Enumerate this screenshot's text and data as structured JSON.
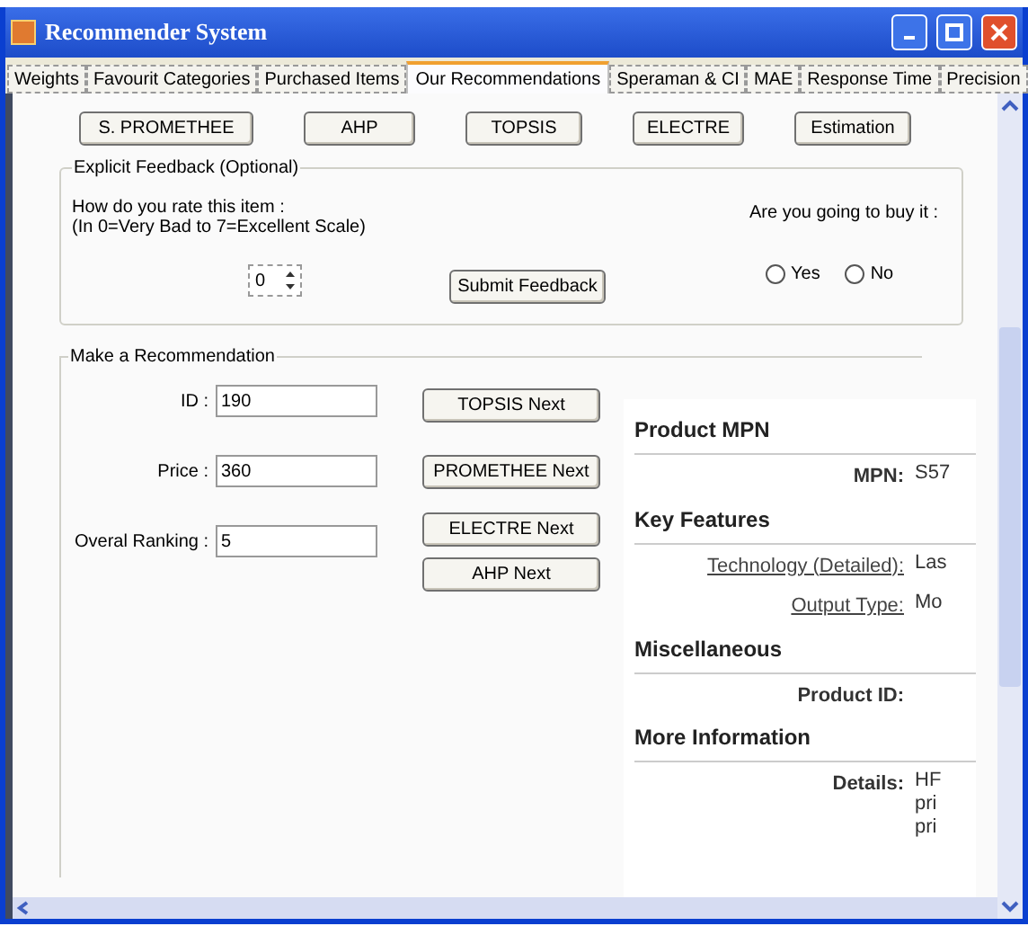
{
  "window": {
    "title": "Recommender System"
  },
  "tabs": [
    {
      "label": "Weights",
      "selected": false
    },
    {
      "label": "Favourit Categories",
      "selected": false
    },
    {
      "label": "Purchased Items",
      "selected": false
    },
    {
      "label": "Our Recommendations",
      "selected": true
    },
    {
      "label": "Speraman & CI",
      "selected": false
    },
    {
      "label": "MAE",
      "selected": false
    },
    {
      "label": "Response Time",
      "selected": false
    },
    {
      "label": "Precision",
      "selected": false
    }
  ],
  "method_buttons": [
    "S. PROMETHEE",
    "AHP",
    "TOPSIS",
    "ELECTRE",
    "Estimation"
  ],
  "feedback": {
    "title": "Explicit Feedback (Optional)",
    "rate_lines": [
      "How do you rate this item :",
      "(In 0=Very Bad to 7=Excellent Scale)"
    ],
    "rating": "0",
    "submit": "Submit Feedback",
    "buy_label": "Are you going to buy it :",
    "options": [
      {
        "label": "Yes",
        "selected": false
      },
      {
        "label": "No",
        "selected": false
      }
    ]
  },
  "recommendation": {
    "title": "Make a Recommendation",
    "fields": [
      {
        "label": "ID :",
        "value": "190"
      },
      {
        "label": "Price :",
        "value": "360"
      },
      {
        "label": "Overal Ranking :",
        "value": "5"
      }
    ],
    "buttons": [
      "TOPSIS Next",
      "PROMETHEE Next",
      "ELECTRE Next",
      "AHP Next"
    ]
  },
  "product": {
    "sections": [
      {
        "heading": "Product MPN",
        "rows": [
          {
            "kind": "plain",
            "label": "MPN:",
            "value": [
              "S57"
            ]
          }
        ]
      },
      {
        "heading": "Key Features",
        "rows": [
          {
            "kind": "link",
            "label": "Technology (Detailed):",
            "value": [
              "Las"
            ]
          },
          {
            "kind": "link",
            "label": "Output Type:",
            "value": [
              "Mo"
            ]
          }
        ]
      },
      {
        "heading": "Miscellaneous",
        "rows": [
          {
            "kind": "plain",
            "label": "Product ID:",
            "value": []
          }
        ]
      },
      {
        "heading": "More Information",
        "rows": [
          {
            "kind": "plain",
            "label": "Details:",
            "value": [
              "HF",
              "pri",
              "pri"
            ]
          }
        ]
      }
    ]
  }
}
